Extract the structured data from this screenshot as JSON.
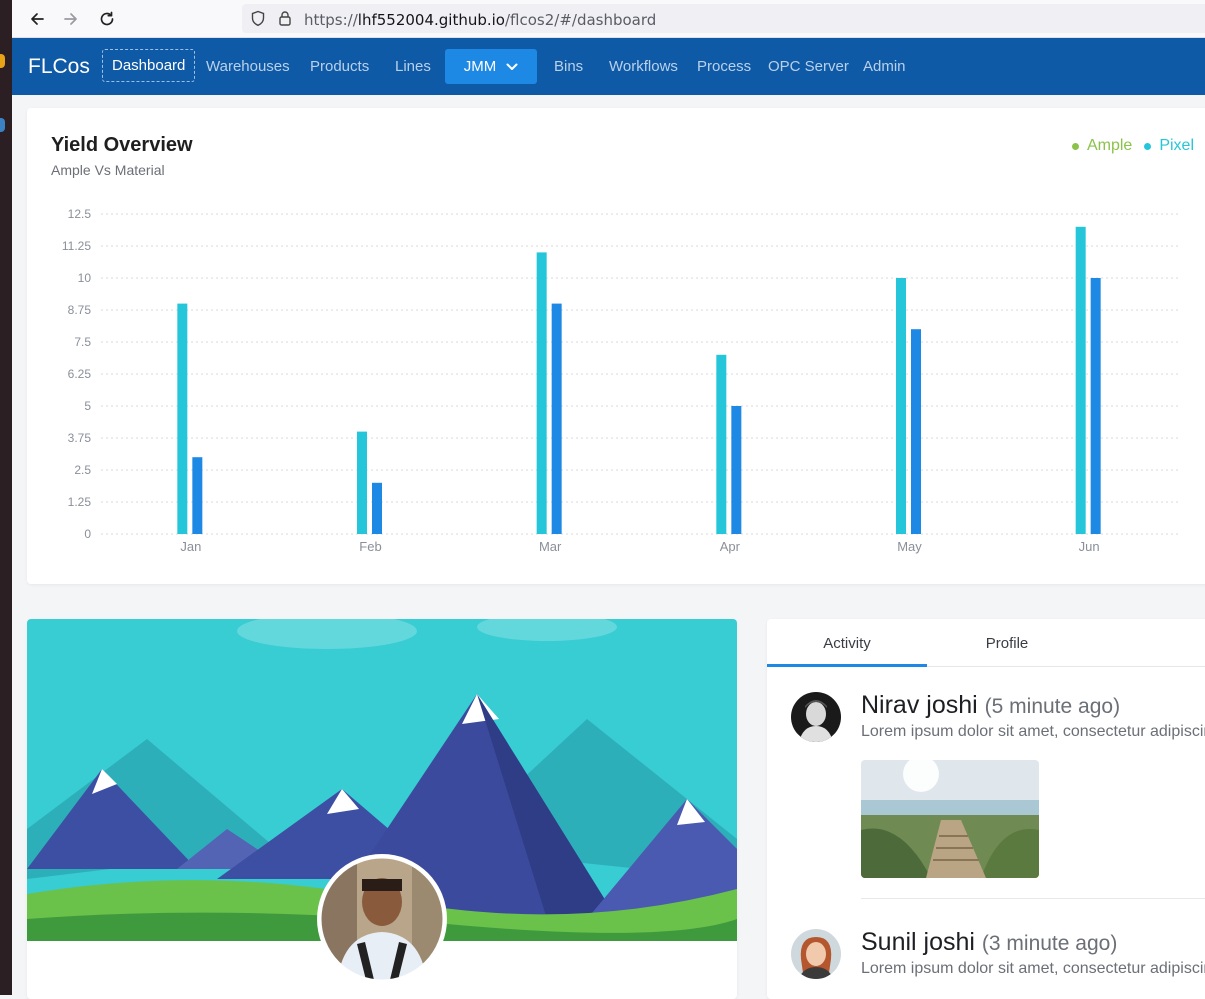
{
  "browser": {
    "url_prefix": "https://",
    "url_domain": "lhf552004.github.io",
    "url_path": "/flcos2/#/dashboard",
    "back_icon": "arrow-left-icon",
    "forward_icon": "arrow-right-icon",
    "reload_icon": "reload-icon",
    "shield_icon": "shield-icon",
    "lock_icon": "lock-icon"
  },
  "navbar": {
    "brand": "FLCos",
    "items": [
      "Dashboard",
      "Warehouses",
      "Products",
      "Lines"
    ],
    "dropdown_label": "JMM",
    "items_after": [
      "Bins",
      "Workflows",
      "Process",
      "OPC Server",
      "Admin"
    ],
    "active": "Dashboard",
    "bg_color": "#0f5aa6",
    "accent_color": "#1e88e5"
  },
  "yield_card": {
    "title": "Yield Overview",
    "subtitle": "Ample Vs Material",
    "legend": [
      {
        "label": "Ample",
        "color": "#8bc34a"
      },
      {
        "label": "Pixel",
        "color": "#26c6da"
      }
    ]
  },
  "chart_data": {
    "type": "bar",
    "categories": [
      "Jan",
      "Feb",
      "Mar",
      "Apr",
      "May",
      "Jun"
    ],
    "series": [
      {
        "name": "Ample",
        "color": "#26c6da",
        "values": [
          9,
          4,
          11,
          7,
          10,
          12
        ]
      },
      {
        "name": "Pixel",
        "color": "#1e88e5",
        "values": [
          3,
          2,
          9,
          5,
          8,
          10
        ]
      }
    ],
    "y_ticks": [
      "0",
      "1.25",
      "2.5",
      "3.75",
      "5",
      "6.25",
      "7.5",
      "8.75",
      "10",
      "11.25",
      "12.5"
    ],
    "ylim": [
      0,
      12.5
    ],
    "grid": true,
    "legend_position": "top-right"
  },
  "activity": {
    "tabs": [
      "Activity",
      "Profile"
    ],
    "active_tab": "Activity",
    "items": [
      {
        "name": "Nirav joshi",
        "time": "(5 minute ago)",
        "text": "Lorem ipsum dolor sit amet, consectetur adipiscing"
      },
      {
        "name": "Sunil joshi",
        "time": "(3 minute ago)",
        "text": "Lorem ipsum dolor sit amet, consectetur adipiscing"
      }
    ]
  }
}
